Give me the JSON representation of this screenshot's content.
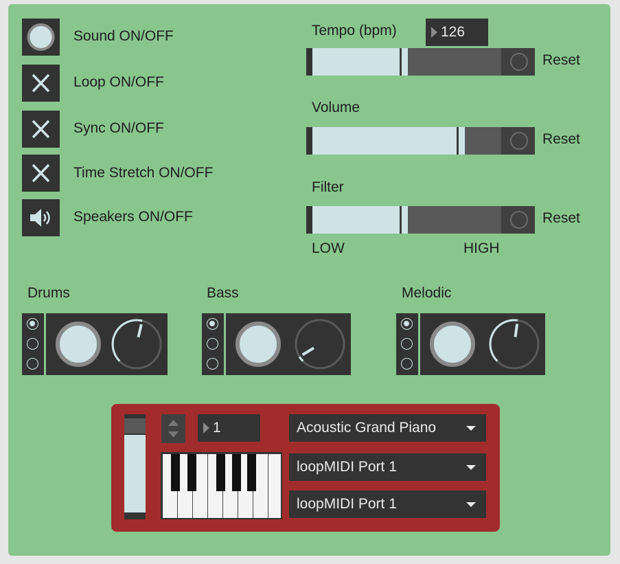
{
  "toggles": [
    {
      "label": "Sound ON/OFF",
      "icon": "circle-icon"
    },
    {
      "label": "Loop ON/OFF",
      "icon": "x-icon"
    },
    {
      "label": "Sync ON/OFF",
      "icon": "x-icon"
    },
    {
      "label": "Time Stretch ON/OFF",
      "icon": "x-icon"
    },
    {
      "label": "Speakers ON/OFF",
      "icon": "speaker-icon"
    }
  ],
  "tempo": {
    "label": "Tempo (bpm)",
    "value": "126",
    "level": 0.48,
    "reset_label": "Reset"
  },
  "volume": {
    "label": "Volume",
    "level": 0.77,
    "reset_label": "Reset"
  },
  "filter": {
    "label": "Filter",
    "level": 0.48,
    "reset_label": "Reset",
    "low_label": "LOW",
    "high_label": "HIGH"
  },
  "channels": [
    {
      "label": "Drums",
      "selected_radio": 0,
      "dial": 0.55
    },
    {
      "label": "Bass",
      "selected_radio": 0,
      "dial": 0.05
    },
    {
      "label": "Melodic",
      "selected_radio": 0,
      "dial": 0.53
    }
  ],
  "midi": {
    "channel_value": "1",
    "instrument": "Acoustic Grand Piano",
    "input_port": "loopMIDI Port 1",
    "output_port": "loopMIDI Port 1"
  },
  "colors": {
    "panel": "#88c68d",
    "control_dark": "#333333",
    "light_fill": "#cfe3e6",
    "keyboard_panel": "#a22c2c"
  }
}
